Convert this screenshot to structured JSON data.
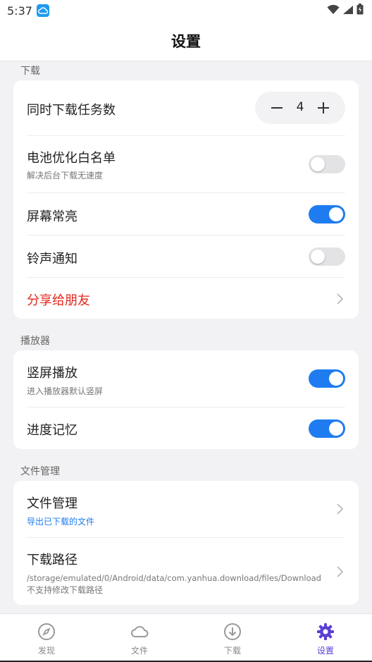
{
  "status_bar": {
    "time": "5:37",
    "app_icon": "cloud-icon",
    "icons": [
      "wifi-icon",
      "signal-icon",
      "battery-icon"
    ]
  },
  "header": {
    "title": "设置"
  },
  "sections": {
    "download": {
      "label": "下载",
      "concurrent_tasks": {
        "label": "同时下载任务数",
        "value": "4",
        "decrement": "minus-icon",
        "increment": "plus-icon"
      },
      "battery_whitelist": {
        "label": "电池优化白名单",
        "sub": "解决后台下载无速度",
        "enabled": false
      },
      "keep_screen_on": {
        "label": "屏幕常亮",
        "enabled": true
      },
      "ringtone_notify": {
        "label": "铃声通知",
        "enabled": false
      },
      "share": {
        "label": "分享给朋友",
        "color": "#e5261c"
      }
    },
    "player": {
      "label": "播放器",
      "portrait_play": {
        "label": "竖屏播放",
        "sub": "进入播放器默认竖屏",
        "enabled": true
      },
      "progress_memory": {
        "label": "进度记忆",
        "enabled": true
      }
    },
    "files": {
      "label": "文件管理",
      "file_manage": {
        "label": "文件管理",
        "sub": "导出已下载的文件",
        "sub_color": "#1e7cf0"
      },
      "download_path": {
        "label": "下载路径",
        "path": "/storage/emulated/0/Android/data/com.yanhua.download/files/Download",
        "note": "不支持修改下载路径"
      }
    }
  },
  "tabs": [
    {
      "label": "发现",
      "icon": "compass-icon",
      "active": false
    },
    {
      "label": "文件",
      "icon": "cloud-icon",
      "active": false
    },
    {
      "label": "下载",
      "icon": "download-icon",
      "active": false
    },
    {
      "label": "设置",
      "icon": "settings-gear-icon",
      "active": true
    }
  ],
  "colors": {
    "accent": "#1e7cf0",
    "active_tab": "#5b3fd6",
    "share_red": "#e5261c",
    "background": "#f2f2f4"
  }
}
